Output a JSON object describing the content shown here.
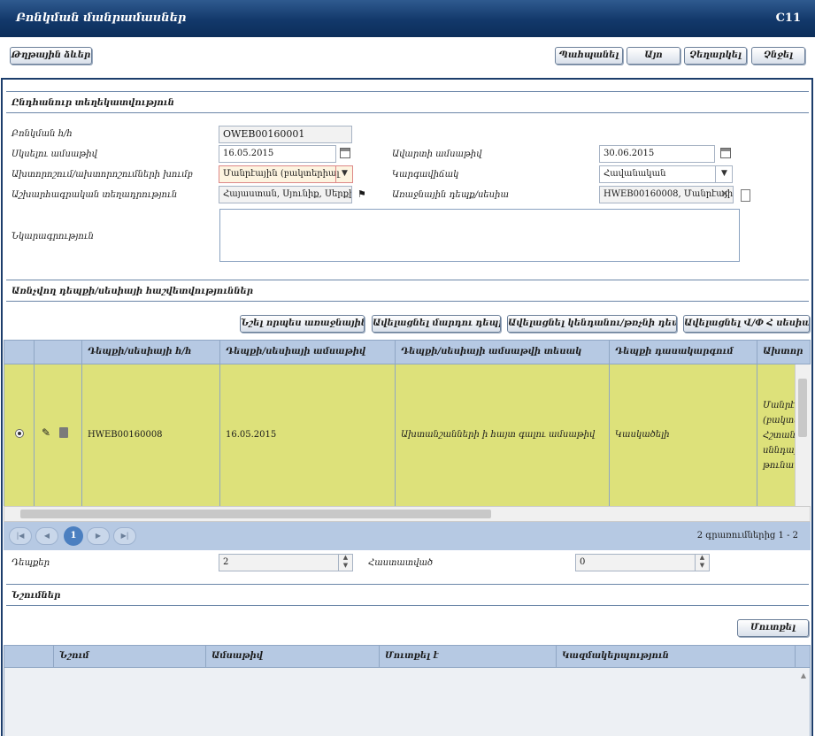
{
  "window": {
    "title": "Բոնկման մանրամասներ",
    "code": "C11"
  },
  "toolbar": {
    "print_label": "Թղթային ձևեր",
    "accept_label": "Պահպանել",
    "ok_label": "Այո",
    "reject_label": "Չեղարկել",
    "close_label": "Չնջել"
  },
  "general": {
    "section_title": "Ընդհանուր տեղեկատվություն",
    "outbreak_no_label": "Բոնկման հ/հ",
    "outbreak_no_value": "OWEB00160001",
    "start_date_label": "Սկսելու ամսաթիվ",
    "start_date_value": "16.05.2015",
    "end_date_label": "Ավարտի ամսաթիվ",
    "end_date_value": "30.06.2015",
    "disease_group_label": "Ախտորոշում/ախտորոշումների խումբ",
    "disease_group_value": "Մանրէային (բակտերիալ",
    "status_label": "Կարգավիճակ",
    "status_value": "Հավանական",
    "location_label": "Աշխարհագրական տեղադրություն",
    "location_value": "Հայաստան, Սյունիք, Սերքի",
    "primary_case_label": "Առաջնային դեպք/սեսիա",
    "primary_case_value": "HWEB00160008, Մանրէայի",
    "description_label": "Նկարագրություն",
    "description_value": ""
  },
  "cases": {
    "section_title": "Առնչվող դեպքի/սեսիայի հաշվետվություններ",
    "btn_mark_primary": "Նշել որպես առաջնային",
    "btn_add_human": "Ավելացնել մարդու դեպք",
    "btn_add_vet": "Ավելացնել կենդանու/թռչնի դեպք",
    "btn_add_session": "Ավելացնել Վ/Փ Հ սեսիա",
    "columns": [
      "Դեպքի/սեսիայի հ/հ",
      "Դեպքի/սեսիայի ամսաթիվ",
      "Դեպքի/սեսիայի ամսաթվի տեսակ",
      "Դեպքի դասակարգում",
      "Ախտոր"
    ],
    "row": {
      "case_id": "HWEB00160008",
      "case_date": "16.05.2015",
      "date_type": "Ախտանշանների ի հայտ գալու ամսաթիվ",
      "classification": "Կասկածելի",
      "diagnosis": "Մանրէ (բակտե Հշտանկ սննդայ թունավ"
    },
    "pager": {
      "page": "1",
      "summary": "2 գրառումներից 1 - 2"
    },
    "count_label": "Դեպքեր",
    "count_value": "2",
    "confirmed_label": "Հաստատված",
    "confirmed_value": "0"
  },
  "notes": {
    "section_title": "Նշումներ",
    "add_label": "Մուտքել",
    "columns": [
      "Նշում",
      "Ամսաթիվ",
      "Մուտքել է",
      "Կազմակերպություն"
    ]
  }
}
